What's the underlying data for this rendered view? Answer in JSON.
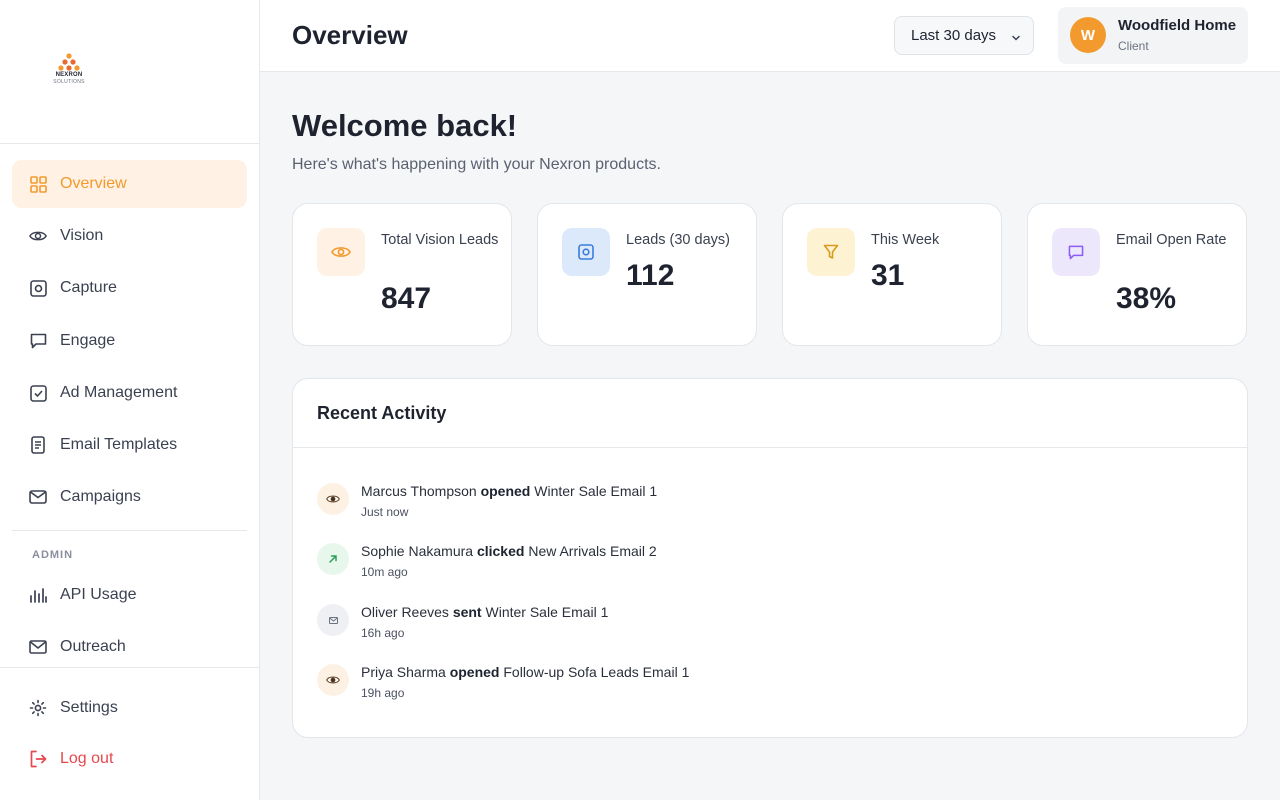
{
  "brand": {
    "name": "NEXRON",
    "sub": "SOLUTIONS"
  },
  "sidebar": {
    "items": [
      {
        "label": "Overview",
        "icon": "grid-icon"
      },
      {
        "label": "Vision",
        "icon": "eye-icon"
      },
      {
        "label": "Capture",
        "icon": "capture-icon"
      },
      {
        "label": "Engage",
        "icon": "chat-icon"
      },
      {
        "label": "Ad Management",
        "icon": "check-square-icon"
      },
      {
        "label": "Email Templates",
        "icon": "document-icon"
      },
      {
        "label": "Campaigns",
        "icon": "mail-icon"
      }
    ],
    "admin_label": "ADMIN",
    "admin_items": [
      {
        "label": "API Usage",
        "icon": "bar-chart-icon"
      },
      {
        "label": "Outreach",
        "icon": "envelope-icon"
      }
    ],
    "settings_label": "Settings",
    "logout_label": "Log out"
  },
  "header": {
    "title": "Overview",
    "range": "Last 30 days",
    "user": {
      "initial": "W",
      "name": "Woodfield Home",
      "role": "Client"
    }
  },
  "main": {
    "welcome": "Welcome back!",
    "subtitle": "Here's what's happening with your Nexron products.",
    "stats": [
      {
        "label": "Total Vision Leads",
        "value": "847",
        "icon": "eye-icon",
        "bg": "#fff1e3",
        "color": "#f29a2e"
      },
      {
        "label": "Leads (30 days)",
        "value": "112",
        "icon": "capture-icon",
        "bg": "#dce9fb",
        "color": "#3b7ddd"
      },
      {
        "label": "This Week",
        "value": "31",
        "icon": "filter-icon",
        "bg": "#fdf3d3",
        "color": "#d99a1e"
      },
      {
        "label": "Email Open Rate",
        "value": "38%",
        "icon": "chat-icon",
        "bg": "#ede7fb",
        "color": "#8b5cf6"
      }
    ],
    "activity": {
      "title": "Recent Activity",
      "items": [
        {
          "name": "Marcus Thompson",
          "action": "opened",
          "target": "Winter Sale Email 1",
          "time": "Just now",
          "icon": "eye-icon"
        },
        {
          "name": "Sophie Nakamura",
          "action": "clicked",
          "target": "New Arrivals Email 2",
          "time": "10m ago",
          "icon": "arrow-up-right-icon"
        },
        {
          "name": "Oliver Reeves",
          "action": "sent",
          "target": "Winter Sale Email 1",
          "time": "16h ago",
          "icon": "envelope-icon"
        },
        {
          "name": "Priya Sharma",
          "action": "opened",
          "target": "Follow-up Sofa Leads Email 1",
          "time": "19h ago",
          "icon": "eye-icon"
        }
      ]
    }
  }
}
